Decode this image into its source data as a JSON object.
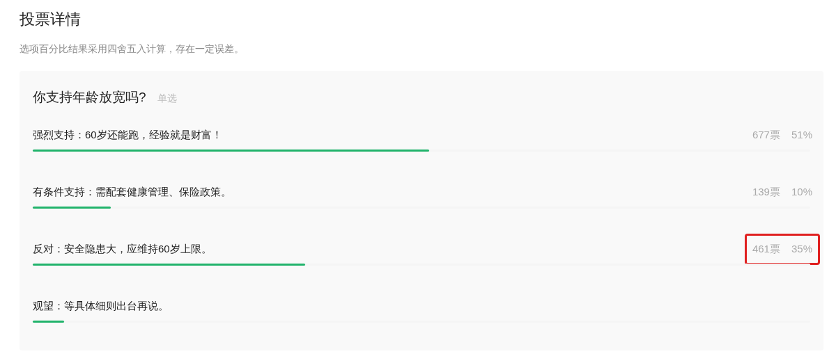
{
  "title": "投票详情",
  "note": "选项百分比结果采用四舍五入计算，存在一定误差。",
  "poll": {
    "question": "你支持年龄放宽吗?",
    "mode": "单选",
    "options": [
      {
        "label": "强烈支持：60岁还能跑，经验就是财富！",
        "stats": {
          "votes": "677票",
          "percent": "51%",
          "highlighted": false
        },
        "level": 0.51
      },
      {
        "label": "有条件支持：需配套健康管理、保险政策。",
        "stats": {
          "votes": "139票",
          "percent": "10%",
          "highlighted": false
        },
        "level": 0.1
      },
      {
        "label": "反对：安全隐患大，应维持60岁上限。",
        "stats": {
          "votes": "461票",
          "percent": "35%",
          "highlighted": true
        },
        "level": 0.35
      },
      {
        "label": "观望：等具体细则出台再说。",
        "level": 0.04
      }
    ]
  }
}
